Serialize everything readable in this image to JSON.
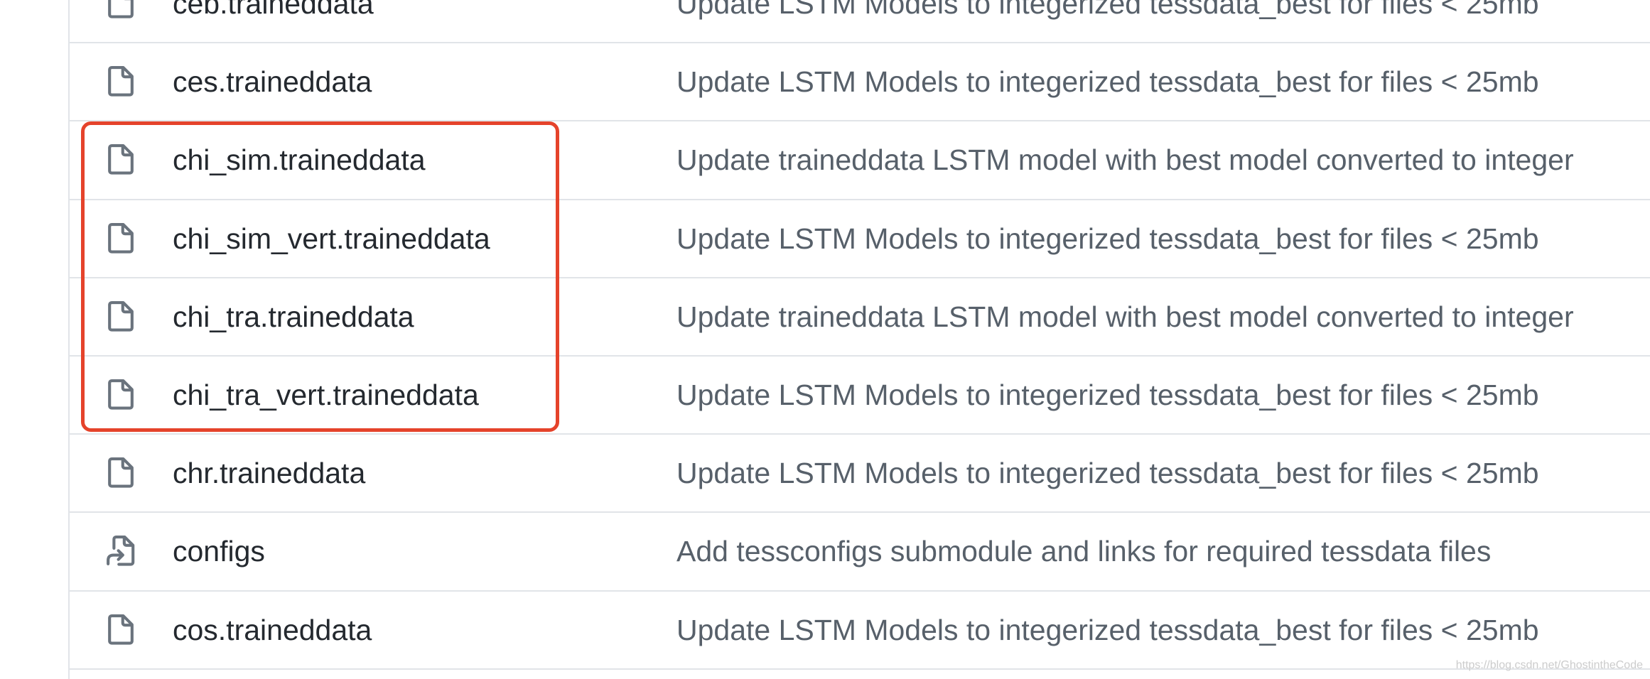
{
  "colors": {
    "name": "#24292f",
    "msg": "#57606a",
    "icon": "#6a737d",
    "border": "#e1e4e8",
    "highlight": "#e5432b",
    "watermark": "#cccccc"
  },
  "rows": [
    {
      "name": "ceb.traineddata",
      "message": "Update LSTM Models to integerized tessdata_best for files < 25mb",
      "icon": "file-icon"
    },
    {
      "name": "ces.traineddata",
      "message": "Update LSTM Models to integerized tessdata_best for files < 25mb",
      "icon": "file-icon"
    },
    {
      "name": "chi_sim.traineddata",
      "message": "Update traineddata LSTM model with best model converted to integer",
      "icon": "file-icon"
    },
    {
      "name": "chi_sim_vert.traineddata",
      "message": "Update LSTM Models to integerized tessdata_best for files < 25mb",
      "icon": "file-icon"
    },
    {
      "name": "chi_tra.traineddata",
      "message": "Update traineddata LSTM model with best model converted to integer",
      "icon": "file-icon"
    },
    {
      "name": "chi_tra_vert.traineddata",
      "message": "Update LSTM Models to integerized tessdata_best for files < 25mb",
      "icon": "file-icon"
    },
    {
      "name": "chr.traineddata",
      "message": "Update LSTM Models to integerized tessdata_best for files < 25mb",
      "icon": "file-icon"
    },
    {
      "name": "configs",
      "message": "Add tessconfigs submodule and links for required tessdata files",
      "icon": "file-symlink-icon"
    },
    {
      "name": "cos.traineddata",
      "message": "Update LSTM Models to integerized tessdata_best for files < 25mb",
      "icon": "file-icon"
    }
  ],
  "watermark": "https://blog.csdn.net/GhostintheCode"
}
